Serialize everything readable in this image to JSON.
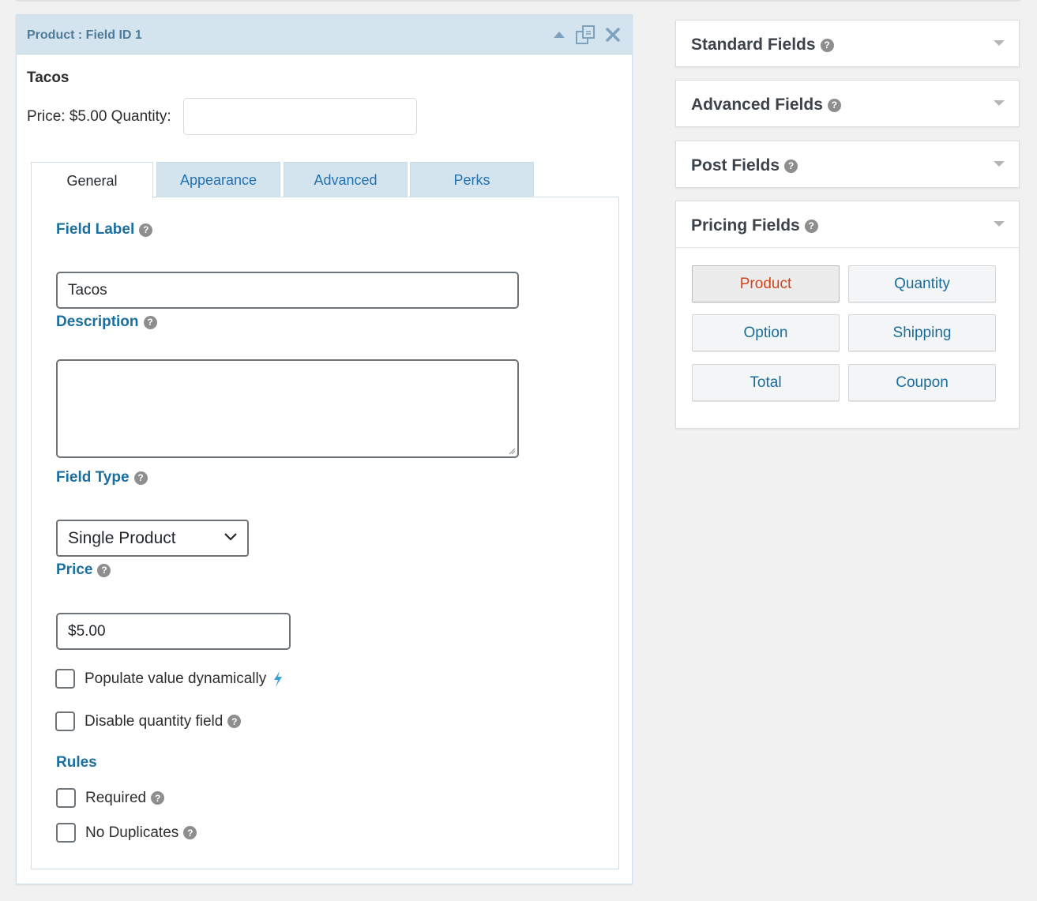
{
  "editor": {
    "header_title": "Product : Field ID 1",
    "preview_label": "Tacos",
    "preview_price_text": "Price: $5.00 Quantity:",
    "tabs": [
      {
        "label": "General"
      },
      {
        "label": "Appearance"
      },
      {
        "label": "Advanced"
      },
      {
        "label": "Perks"
      }
    ],
    "field_label": {
      "title": "Field Label",
      "value": "Tacos"
    },
    "description": {
      "title": "Description",
      "value": ""
    },
    "field_type": {
      "title": "Field Type",
      "selected": "Single Product"
    },
    "price": {
      "title": "Price",
      "value": "$5.00"
    },
    "populate_dynamically": {
      "label": "Populate value dynamically",
      "checked": false
    },
    "disable_quantity": {
      "label": "Disable quantity field",
      "checked": false
    },
    "rules": {
      "title": "Rules",
      "required": {
        "label": "Required",
        "checked": false
      },
      "no_duplicates": {
        "label": "No Duplicates",
        "checked": false
      }
    }
  },
  "sidebar": {
    "panels": [
      {
        "title": "Standard Fields"
      },
      {
        "title": "Advanced Fields"
      },
      {
        "title": "Post Fields"
      },
      {
        "title": "Pricing Fields"
      }
    ],
    "pricing_buttons": [
      {
        "label": "Product"
      },
      {
        "label": "Quantity"
      },
      {
        "label": "Option"
      },
      {
        "label": "Shipping"
      },
      {
        "label": "Total"
      },
      {
        "label": "Coupon"
      }
    ]
  },
  "icons": {
    "help": "?",
    "collapse": "triangle-up-icon",
    "duplicate": "duplicate-icon",
    "delete": "close-icon",
    "bolt": "lightning-bolt-icon"
  },
  "colors": {
    "accent": "#1b6f9e",
    "header_bg": "#d4e4ef",
    "selected_button_text": "#d1441c",
    "bolt": "#3ba1da"
  }
}
